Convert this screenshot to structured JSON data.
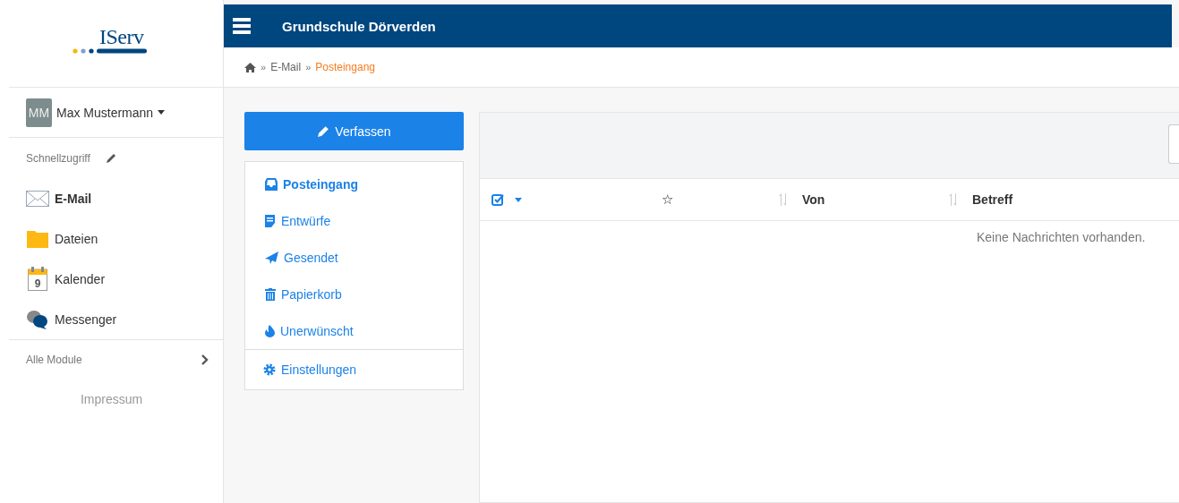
{
  "logo": {
    "text": "IServ"
  },
  "user": {
    "initials": "MM",
    "name": "Max Mustermann"
  },
  "quick_access": {
    "label": "Schnellzugriff"
  },
  "modules": [
    {
      "kind": "mail",
      "label": "E-Mail",
      "selected": true
    },
    {
      "kind": "files",
      "label": "Dateien",
      "selected": false
    },
    {
      "kind": "calendar",
      "label": "Kalender",
      "selected": false,
      "icon_text": "9"
    },
    {
      "kind": "messenger",
      "label": "Messenger",
      "selected": false
    }
  ],
  "all_modules": {
    "label": "Alle Module"
  },
  "imprint": {
    "label": "Impressum"
  },
  "header": {
    "title": "Grundschule Dörverden"
  },
  "breadcrumb": [
    {
      "separator": "»",
      "label": "E-Mail",
      "selected": false
    },
    {
      "separator": "»",
      "label": "Posteingang",
      "selected": true
    }
  ],
  "compose": {
    "label": "Verfassen"
  },
  "folders": [
    {
      "kind": "inbox",
      "label": "Posteingang",
      "selected": true
    },
    {
      "kind": "drafts",
      "label": "Entwürfe",
      "selected": false
    },
    {
      "kind": "sent",
      "label": "Gesendet",
      "selected": false
    },
    {
      "kind": "trash",
      "label": "Papierkorb",
      "selected": false
    },
    {
      "kind": "spam",
      "label": "Unerwünscht",
      "selected": false
    }
  ],
  "settings": {
    "label": "Einstellungen"
  },
  "table": {
    "star": "☆",
    "columns": [
      "Von",
      "Betreff"
    ],
    "empty": "Keine Nachrichten vorhanden."
  }
}
